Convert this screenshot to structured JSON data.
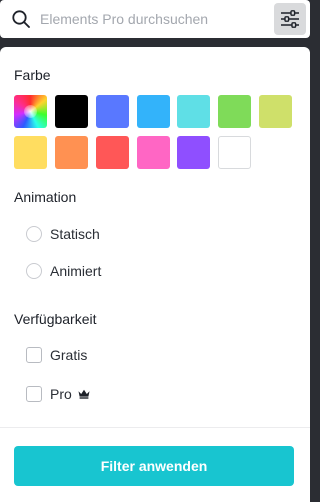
{
  "search": {
    "placeholder": "Elements Pro durchsuchen",
    "icon": "search-icon",
    "filter_icon": "sliders-icon"
  },
  "color_section": {
    "title": "Farbe",
    "swatches": [
      {
        "name": "rainbow",
        "color": "rainbow-gradient"
      },
      {
        "name": "black",
        "color": "#000000"
      },
      {
        "name": "blue",
        "color": "#5978ff"
      },
      {
        "name": "sky-blue",
        "color": "#33b3fa"
      },
      {
        "name": "turquoise",
        "color": "#5fdfe6"
      },
      {
        "name": "green",
        "color": "#7fdb59"
      },
      {
        "name": "lime",
        "color": "#cfe06a"
      },
      {
        "name": "yellow",
        "color": "#ffdd60"
      },
      {
        "name": "orange",
        "color": "#ff9152"
      },
      {
        "name": "red",
        "color": "#ff5757"
      },
      {
        "name": "pink",
        "color": "#ff66c4"
      },
      {
        "name": "purple",
        "color": "#8f4fff"
      },
      {
        "name": "white",
        "color": "#ffffff"
      }
    ]
  },
  "animation_section": {
    "title": "Animation",
    "options": [
      "Statisch",
      "Animiert"
    ]
  },
  "availability_section": {
    "title": "Verfügbarkeit",
    "options": [
      "Gratis",
      "Pro"
    ],
    "pro_icon": "crown-icon"
  },
  "apply_button": {
    "label": "Filter anwenden",
    "color": "#18c5d0"
  }
}
